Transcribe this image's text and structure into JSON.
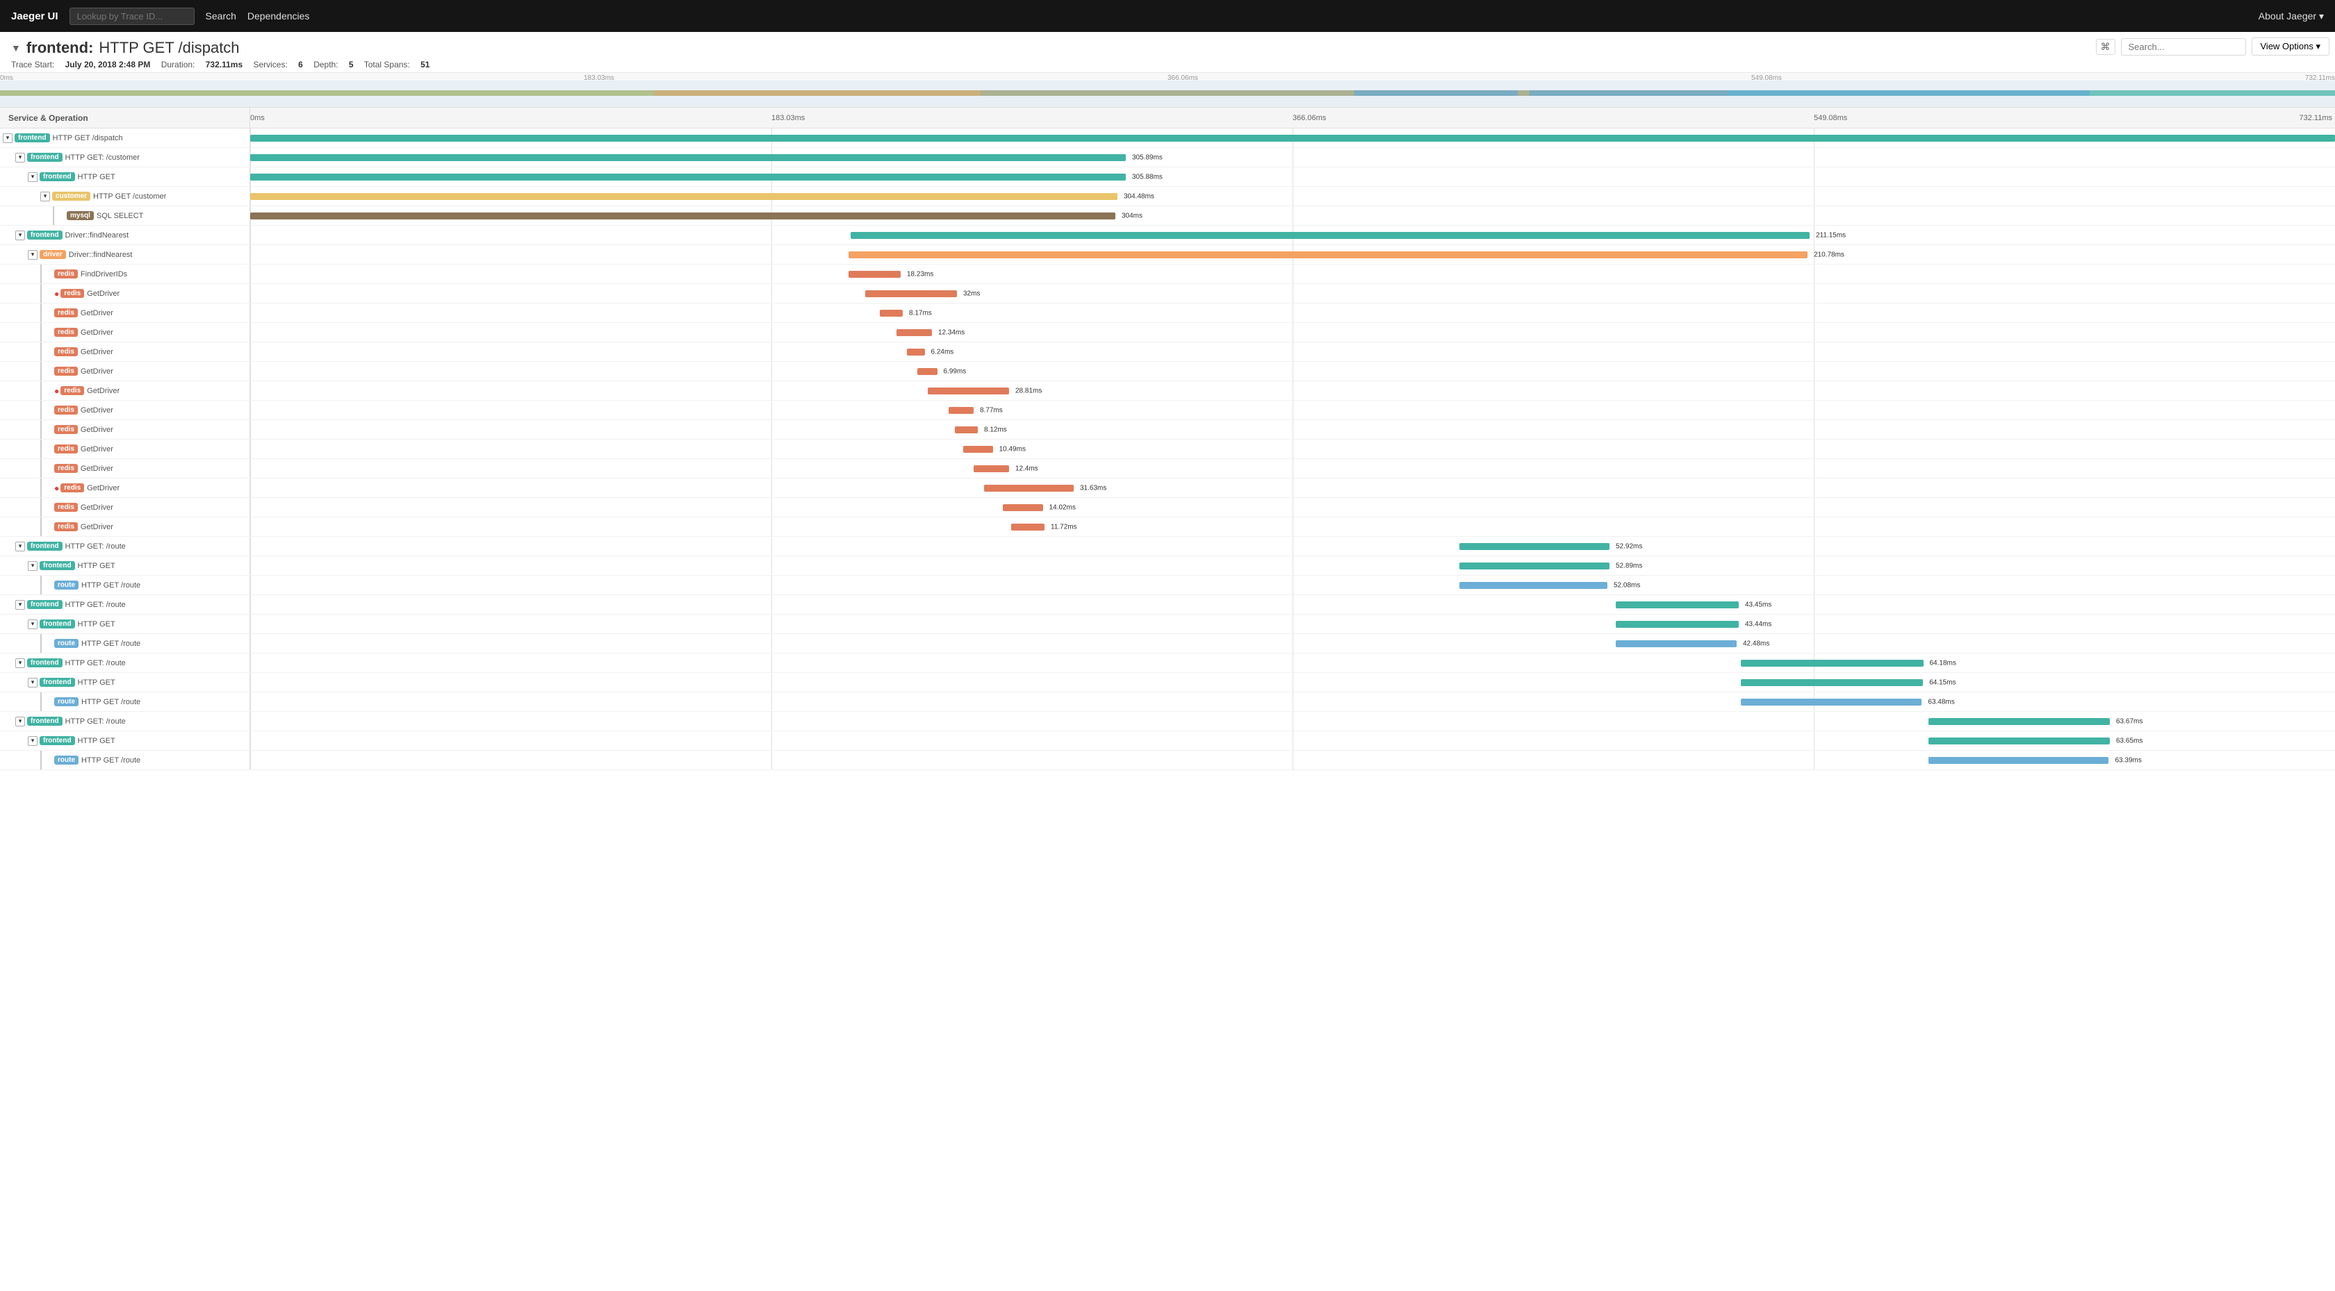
{
  "nav": {
    "brand": "Jaeger UI",
    "lookup_placeholder": "Lookup by Trace ID...",
    "search_label": "Search",
    "dependencies_label": "Dependencies",
    "about_label": "About Jaeger ▾"
  },
  "trace": {
    "title_chevron": "▼",
    "service_name": "frontend:",
    "operation_name": "HTTP GET /dispatch",
    "trace_start_label": "Trace Start:",
    "trace_start_value": "July 20, 2018 2:48 PM",
    "duration_label": "Duration:",
    "duration_value": "732.11ms",
    "services_label": "Services:",
    "services_value": "6",
    "depth_label": "Depth:",
    "depth_value": "5",
    "total_spans_label": "Total Spans:",
    "total_spans_value": "51"
  },
  "toolbar": {
    "search_placeholder": "Search...",
    "cmd_icon": "⌘",
    "view_options_label": "View Options ▾"
  },
  "timeline": {
    "header_service_label": "Service & Operation",
    "time_markers": [
      "0ms",
      "183.03ms",
      "366.06ms",
      "549.08ms",
      "732.11ms"
    ]
  },
  "minimap": {
    "labels": [
      "0ms",
      "183.03ms",
      "366.06ms",
      "549.08ms",
      "732.11ms"
    ]
  },
  "spans": [
    {
      "id": 1,
      "indent": 0,
      "toggle": "▼",
      "service": "frontend",
      "badge_class": "badge-frontend",
      "operation": "HTTP GET /dispatch",
      "offset_pct": 0,
      "width_pct": 100,
      "color": "color-teal",
      "duration_label": "",
      "label_right_pct": null,
      "error": false
    },
    {
      "id": 2,
      "indent": 1,
      "toggle": "▼",
      "service": "frontend",
      "badge_class": "badge-frontend",
      "operation": "HTTP GET: /customer",
      "offset_pct": 0,
      "width_pct": 42,
      "color": "color-teal",
      "duration_label": "305.89ms",
      "error": false
    },
    {
      "id": 3,
      "indent": 2,
      "toggle": "▼",
      "service": "frontend",
      "badge_class": "badge-frontend",
      "operation": "HTTP GET",
      "offset_pct": 0,
      "width_pct": 42,
      "color": "color-teal",
      "duration_label": "305.88ms",
      "error": false
    },
    {
      "id": 4,
      "indent": 3,
      "toggle": "▼",
      "service": "customer",
      "badge_class": "badge-customer",
      "operation": "HTTP GET /customer",
      "offset_pct": 0,
      "width_pct": 41.6,
      "color": "color-yellow",
      "duration_label": "304.48ms",
      "error": false
    },
    {
      "id": 5,
      "indent": 4,
      "toggle": null,
      "service": "mysql",
      "badge_class": "badge-mysql",
      "operation": "SQL SELECT",
      "offset_pct": 0,
      "width_pct": 41.5,
      "color": "color-brown",
      "duration_label": "304ms",
      "error": false
    },
    {
      "id": 6,
      "indent": 1,
      "toggle": "▼",
      "service": "frontend",
      "badge_class": "badge-frontend",
      "operation": "Driver::findNearest",
      "offset_pct": 28.8,
      "width_pct": 46,
      "color": "color-teal",
      "duration_label": "211.15ms",
      "error": false
    },
    {
      "id": 7,
      "indent": 2,
      "toggle": "▼",
      "service": "driver",
      "badge_class": "badge-driver",
      "operation": "Driver::findNearest",
      "offset_pct": 28.7,
      "width_pct": 46,
      "color": "color-orange",
      "duration_label": "210.78ms",
      "error": false
    },
    {
      "id": 8,
      "indent": 3,
      "toggle": null,
      "service": "redis",
      "badge_class": "badge-redis",
      "operation": "FindDriverIDs",
      "offset_pct": 28.7,
      "width_pct": 2.5,
      "color": "color-redis",
      "duration_label": "18.23ms",
      "error": false
    },
    {
      "id": 9,
      "indent": 3,
      "toggle": null,
      "service": "redis",
      "badge_class": "badge-redis",
      "operation": "GetDriver",
      "offset_pct": 29.5,
      "width_pct": 4.4,
      "color": "color-redis",
      "duration_label": "32ms",
      "error": true
    },
    {
      "id": 10,
      "indent": 3,
      "toggle": null,
      "service": "redis",
      "badge_class": "badge-redis",
      "operation": "GetDriver",
      "offset_pct": 30.2,
      "width_pct": 1.1,
      "color": "color-redis",
      "duration_label": "8.17ms",
      "error": false
    },
    {
      "id": 11,
      "indent": 3,
      "toggle": null,
      "service": "redis",
      "badge_class": "badge-redis",
      "operation": "GetDriver",
      "offset_pct": 31.0,
      "width_pct": 1.7,
      "color": "color-redis",
      "duration_label": "12.34ms",
      "error": false
    },
    {
      "id": 12,
      "indent": 3,
      "toggle": null,
      "service": "redis",
      "badge_class": "badge-redis",
      "operation": "GetDriver",
      "offset_pct": 31.5,
      "width_pct": 0.85,
      "color": "color-redis",
      "duration_label": "6.24ms",
      "error": false
    },
    {
      "id": 13,
      "indent": 3,
      "toggle": null,
      "service": "redis",
      "badge_class": "badge-redis",
      "operation": "GetDriver",
      "offset_pct": 32.0,
      "width_pct": 0.95,
      "color": "color-redis",
      "duration_label": "6.99ms",
      "error": false
    },
    {
      "id": 14,
      "indent": 3,
      "toggle": null,
      "service": "redis",
      "badge_class": "badge-redis",
      "operation": "GetDriver",
      "offset_pct": 32.5,
      "width_pct": 3.9,
      "color": "color-redis",
      "duration_label": "28.81ms",
      "error": true
    },
    {
      "id": 15,
      "indent": 3,
      "toggle": null,
      "service": "redis",
      "badge_class": "badge-redis",
      "operation": "GetDriver",
      "offset_pct": 33.5,
      "width_pct": 1.2,
      "color": "color-redis",
      "duration_label": "8.77ms",
      "error": false
    },
    {
      "id": 16,
      "indent": 3,
      "toggle": null,
      "service": "redis",
      "badge_class": "badge-redis",
      "operation": "GetDriver",
      "offset_pct": 33.8,
      "width_pct": 1.1,
      "color": "color-redis",
      "duration_label": "8.12ms",
      "error": false
    },
    {
      "id": 17,
      "indent": 3,
      "toggle": null,
      "service": "redis",
      "badge_class": "badge-redis",
      "operation": "GetDriver",
      "offset_pct": 34.2,
      "width_pct": 1.42,
      "color": "color-redis",
      "duration_label": "10.49ms",
      "error": false
    },
    {
      "id": 18,
      "indent": 3,
      "toggle": null,
      "service": "redis",
      "badge_class": "badge-redis",
      "operation": "GetDriver",
      "offset_pct": 34.7,
      "width_pct": 1.7,
      "color": "color-redis",
      "duration_label": "12.4ms",
      "error": false
    },
    {
      "id": 19,
      "indent": 3,
      "toggle": null,
      "service": "redis",
      "badge_class": "badge-redis",
      "operation": "GetDriver",
      "offset_pct": 35.2,
      "width_pct": 4.3,
      "color": "color-redis",
      "duration_label": "31.63ms",
      "error": true
    },
    {
      "id": 20,
      "indent": 3,
      "toggle": null,
      "service": "redis",
      "badge_class": "badge-redis",
      "operation": "GetDriver",
      "offset_pct": 36.1,
      "width_pct": 1.92,
      "color": "color-redis",
      "duration_label": "14.02ms",
      "error": false
    },
    {
      "id": 21,
      "indent": 3,
      "toggle": null,
      "service": "redis",
      "badge_class": "badge-redis",
      "operation": "GetDriver",
      "offset_pct": 36.5,
      "width_pct": 1.6,
      "color": "color-redis",
      "duration_label": "11.72ms",
      "error": false
    },
    {
      "id": 22,
      "indent": 1,
      "toggle": "▼",
      "service": "frontend",
      "badge_class": "badge-frontend",
      "operation": "HTTP GET: /route",
      "offset_pct": 58.0,
      "width_pct": 7.2,
      "color": "color-teal",
      "duration_label": "52.92ms",
      "error": false
    },
    {
      "id": 23,
      "indent": 2,
      "toggle": "▼",
      "service": "frontend",
      "badge_class": "badge-frontend",
      "operation": "HTTP GET",
      "offset_pct": 58.0,
      "width_pct": 7.2,
      "color": "color-teal",
      "duration_label": "52.89ms",
      "error": false
    },
    {
      "id": 24,
      "indent": 3,
      "toggle": null,
      "service": "route",
      "badge_class": "badge-route",
      "operation": "HTTP GET /route",
      "offset_pct": 58.0,
      "width_pct": 7.1,
      "color": "color-blue",
      "duration_label": "52.08ms",
      "error": false
    },
    {
      "id": 25,
      "indent": 1,
      "toggle": "▼",
      "service": "frontend",
      "badge_class": "badge-frontend",
      "operation": "HTTP GET: /route",
      "offset_pct": 65.5,
      "width_pct": 5.9,
      "color": "color-teal",
      "duration_label": "43.45ms",
      "error": false
    },
    {
      "id": 26,
      "indent": 2,
      "toggle": "▼",
      "service": "frontend",
      "badge_class": "badge-frontend",
      "operation": "HTTP GET",
      "offset_pct": 65.5,
      "width_pct": 5.9,
      "color": "color-teal",
      "duration_label": "43.44ms",
      "error": false
    },
    {
      "id": 27,
      "indent": 3,
      "toggle": null,
      "service": "route",
      "badge_class": "badge-route",
      "operation": "HTTP GET /route",
      "offset_pct": 65.5,
      "width_pct": 5.8,
      "color": "color-blue",
      "duration_label": "42.48ms",
      "error": false
    },
    {
      "id": 28,
      "indent": 1,
      "toggle": "▼",
      "service": "frontend",
      "badge_class": "badge-frontend",
      "operation": "HTTP GET: /route",
      "offset_pct": 71.5,
      "width_pct": 8.75,
      "color": "color-teal",
      "duration_label": "64.18ms",
      "error": false
    },
    {
      "id": 29,
      "indent": 2,
      "toggle": "▼",
      "service": "frontend",
      "badge_class": "badge-frontend",
      "operation": "HTTP GET",
      "offset_pct": 71.5,
      "width_pct": 8.74,
      "color": "color-teal",
      "duration_label": "64.15ms",
      "error": false
    },
    {
      "id": 30,
      "indent": 3,
      "toggle": null,
      "service": "route",
      "badge_class": "badge-route",
      "operation": "HTTP GET /route",
      "offset_pct": 71.5,
      "width_pct": 8.68,
      "color": "color-blue",
      "duration_label": "63.48ms",
      "error": false
    },
    {
      "id": 31,
      "indent": 1,
      "toggle": "▼",
      "service": "frontend",
      "badge_class": "badge-frontend",
      "operation": "HTTP GET: /route",
      "offset_pct": 80.5,
      "width_pct": 8.7,
      "color": "color-teal",
      "duration_label": "63.67ms",
      "error": false
    },
    {
      "id": 32,
      "indent": 2,
      "toggle": "▼",
      "service": "frontend",
      "badge_class": "badge-frontend",
      "operation": "HTTP GET",
      "offset_pct": 80.5,
      "width_pct": 8.7,
      "color": "color-teal",
      "duration_label": "63.65ms",
      "error": false
    },
    {
      "id": 33,
      "indent": 3,
      "toggle": null,
      "service": "route",
      "badge_class": "badge-route",
      "operation": "HTTP GET /route",
      "offset_pct": 80.5,
      "width_pct": 8.65,
      "color": "color-blue",
      "duration_label": "63.39ms",
      "error": false
    }
  ]
}
